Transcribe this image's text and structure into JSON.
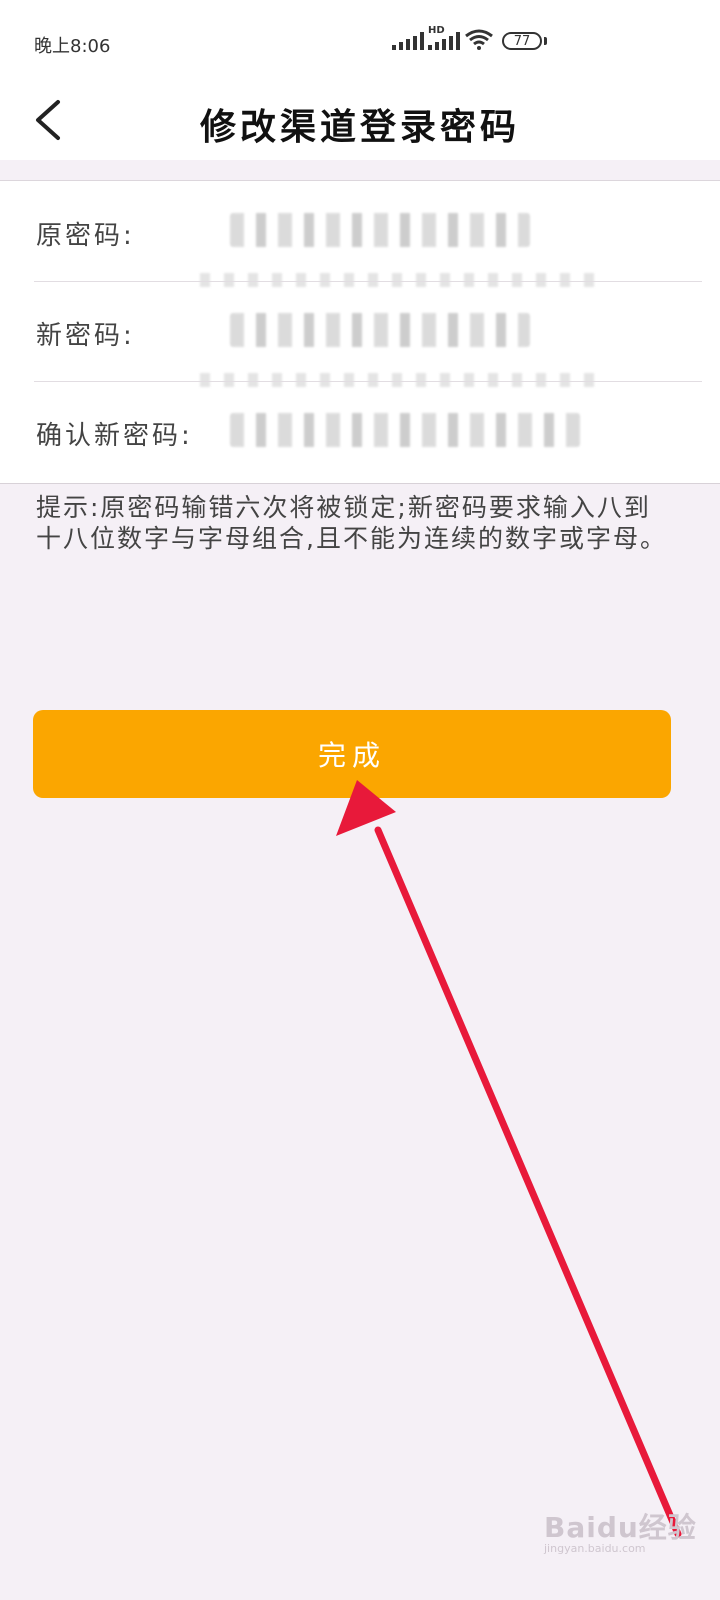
{
  "status_bar": {
    "time": "晚上8:06",
    "network_label": "HD",
    "battery_level": "77"
  },
  "header": {
    "title": "修改渠道登录密码",
    "back_icon": "chevron-left-icon"
  },
  "form": {
    "fields": [
      {
        "label": "原密码:",
        "value_obscured": true
      },
      {
        "label": "新密码:",
        "value_obscured": true
      },
      {
        "label": "确认新密码:",
        "value_obscured": true
      }
    ]
  },
  "hint": "提示:原密码输错六次将被锁定;新密码要求输入八到十八位数字与字母组合,且不能为连续的数字或字母。",
  "done_button": {
    "label": "完成"
  },
  "colors": {
    "accent": "#fba600",
    "annotation_arrow": "#e8193a",
    "background": "#f5f0f6"
  },
  "watermark": {
    "brand": "Baidu经验",
    "url": "jingyan.baidu.com"
  }
}
